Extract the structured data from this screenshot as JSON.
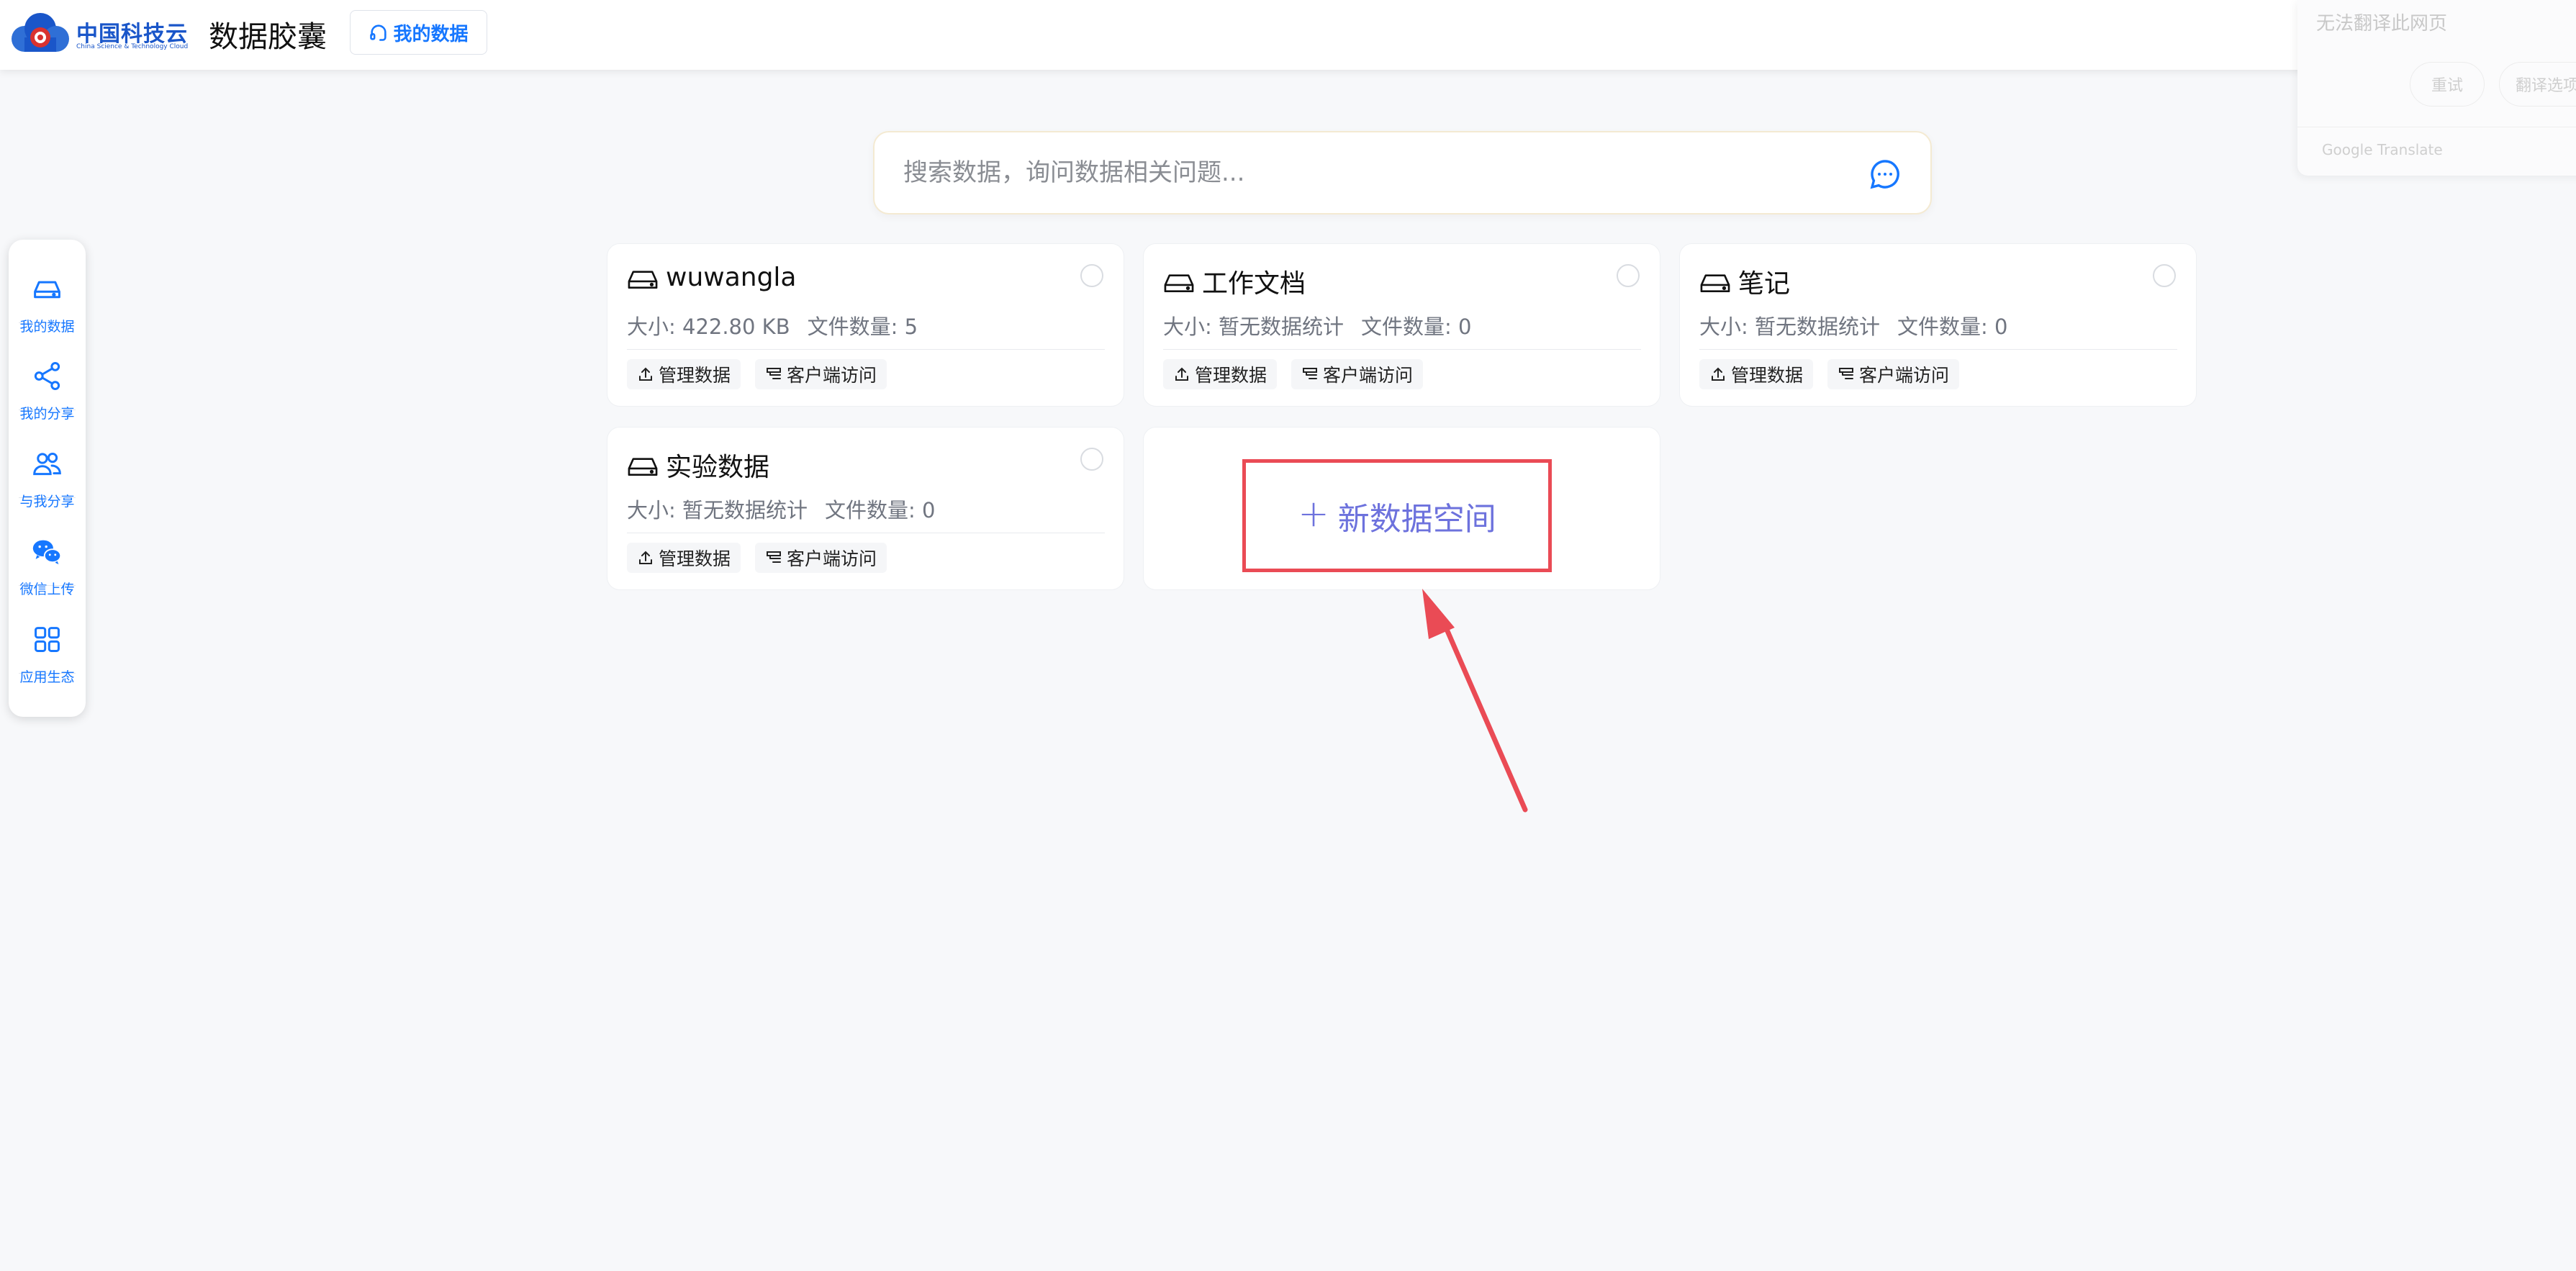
{
  "header": {
    "logo_cn": "中国科技云",
    "logo_en": "China Science & Technology Cloud",
    "app_title": "数据胶囊",
    "tab_label": "我的数据"
  },
  "translate_popup": {
    "message": "无法翻译此网页",
    "retry_label": "重试",
    "options_label": "翻译选项",
    "credit": "Google Translate"
  },
  "sidebar": {
    "items": [
      {
        "label": "我的数据",
        "icon": "drive-icon"
      },
      {
        "label": "我的分享",
        "icon": "share-icon"
      },
      {
        "label": "与我分享",
        "icon": "users-icon"
      },
      {
        "label": "微信上传",
        "icon": "wechat-icon"
      },
      {
        "label": "应用生态",
        "icon": "grid-icon"
      }
    ]
  },
  "search": {
    "placeholder": "搜索数据，询问数据相关问题..."
  },
  "spaces": [
    {
      "name": "wuwangla",
      "size": "大小: 422.80 KB",
      "files": "文件数量: 5",
      "manage_label": "管理数据",
      "client_label": "客户端访问"
    },
    {
      "name": "工作文档",
      "size": "大小: 暂无数据统计",
      "files": "文件数量: 0",
      "manage_label": "管理数据",
      "client_label": "客户端访问"
    },
    {
      "name": "笔记",
      "size": "大小: 暂无数据统计",
      "files": "文件数量: 0",
      "manage_label": "管理数据",
      "client_label": "客户端访问"
    },
    {
      "name": "实验数据",
      "size": "大小: 暂无数据统计",
      "files": "文件数量: 0",
      "manage_label": "管理数据",
      "client_label": "客户端访问"
    }
  ],
  "new_space": {
    "plus": "+",
    "label": "新数据空间"
  },
  "colors": {
    "accent": "#1677ff",
    "annotation_red": "#ea4b55",
    "new_space_text": "#6d72dd"
  }
}
